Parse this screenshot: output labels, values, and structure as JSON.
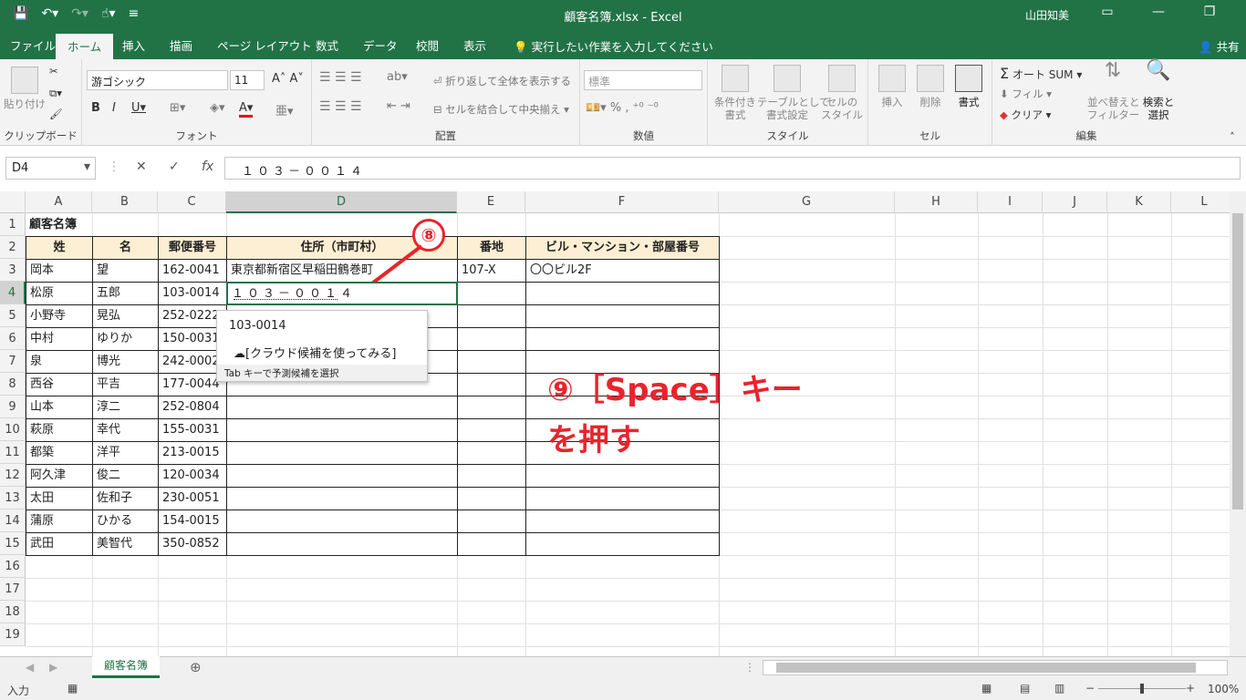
{
  "window": {
    "title": "顧客名簿.xlsx  -  Excel",
    "user": "山田知美"
  },
  "tabs": [
    "ファイル",
    "ホーム",
    "挿入",
    "描画",
    "ページ レイアウト",
    "数式",
    "データ",
    "校閲",
    "表示"
  ],
  "tell_me": "実行したい作業を入力してください",
  "share": "共有",
  "ribbon": {
    "clipboard": {
      "paste": "貼り付け",
      "label": "クリップボード"
    },
    "font": {
      "name": "游ゴシック",
      "size": "11",
      "label": "フォント"
    },
    "align": {
      "wrap": "折り返して全体を表示する",
      "merge": "セルを結合して中央揃え",
      "label": "配置"
    },
    "number": {
      "format": "標準",
      "label": "数値"
    },
    "styles": {
      "cond": "条件付き\n書式",
      "table": "テーブルとして\n書式設定",
      "cell": "セルの\nスタイル",
      "label": "スタイル"
    },
    "cells": {
      "insert": "挿入",
      "delete": "削除",
      "format": "書式",
      "label": "セル"
    },
    "editing": {
      "autosum": "オート SUM",
      "fill": "フィル",
      "clear": "クリア",
      "sort": "並べ替えと\nフィルター",
      "find": "検索と\n選択",
      "label": "編集"
    }
  },
  "namebox": "D4",
  "formula": "１０３－００１４",
  "columns": [
    "A",
    "B",
    "C",
    "D",
    "E",
    "F",
    "G",
    "H",
    "I",
    "J",
    "K",
    "L"
  ],
  "rows": [
    "1",
    "2",
    "3",
    "4",
    "5",
    "6",
    "7",
    "8",
    "9",
    "10",
    "11",
    "12",
    "13",
    "14",
    "15",
    "16",
    "17",
    "18",
    "19"
  ],
  "sheet": {
    "title": "顧客名簿",
    "headers": [
      "姓",
      "名",
      "郵便番号",
      "住所（市町村）",
      "番地",
      "ビル・マンション・部屋番号"
    ],
    "data": [
      [
        "岡本",
        "望",
        "162-0041",
        "東京都新宿区早稲田鶴巻町",
        "107-X",
        "〇〇ビル2F"
      ],
      [
        "松原",
        "五郎",
        "103-0014",
        "１０３－００１４",
        "",
        ""
      ],
      [
        "小野寺",
        "晃弘",
        "252-0222",
        "",
        "",
        ""
      ],
      [
        "中村",
        "ゆりか",
        "150-0031",
        "",
        "",
        ""
      ],
      [
        "泉",
        "博光",
        "242-0002",
        "",
        "",
        ""
      ],
      [
        "西谷",
        "平吉",
        "177-0044",
        "",
        "",
        ""
      ],
      [
        "山本",
        "淳二",
        "252-0804",
        "",
        "",
        ""
      ],
      [
        "萩原",
        "幸代",
        "155-0031",
        "",
        "",
        ""
      ],
      [
        "都築",
        "洋平",
        "213-0015",
        "",
        "",
        ""
      ],
      [
        "阿久津",
        "俊二",
        "120-0034",
        "",
        "",
        ""
      ],
      [
        "太田",
        "佐和子",
        "230-0051",
        "",
        "",
        ""
      ],
      [
        "蒲原",
        "ひかる",
        "154-0015",
        "",
        "",
        ""
      ],
      [
        "武田",
        "美智代",
        "350-0852",
        "",
        "",
        ""
      ]
    ]
  },
  "autocomplete": {
    "suggestion": "103-0014",
    "cloud": "[クラウド候補を使ってみる]",
    "hint": "Tab キーで予測候補を選択"
  },
  "annotations": {
    "step8": "⑧",
    "step9_line1": "⑨［Space］キー",
    "step9_line2": "を押す"
  },
  "sheet_tab": "顧客名簿",
  "status": {
    "mode": "入力",
    "zoom": "100%"
  },
  "colors": {
    "excel_green": "#217346",
    "annotation_red": "#e8242c",
    "header_fill": "#fdefd3"
  }
}
